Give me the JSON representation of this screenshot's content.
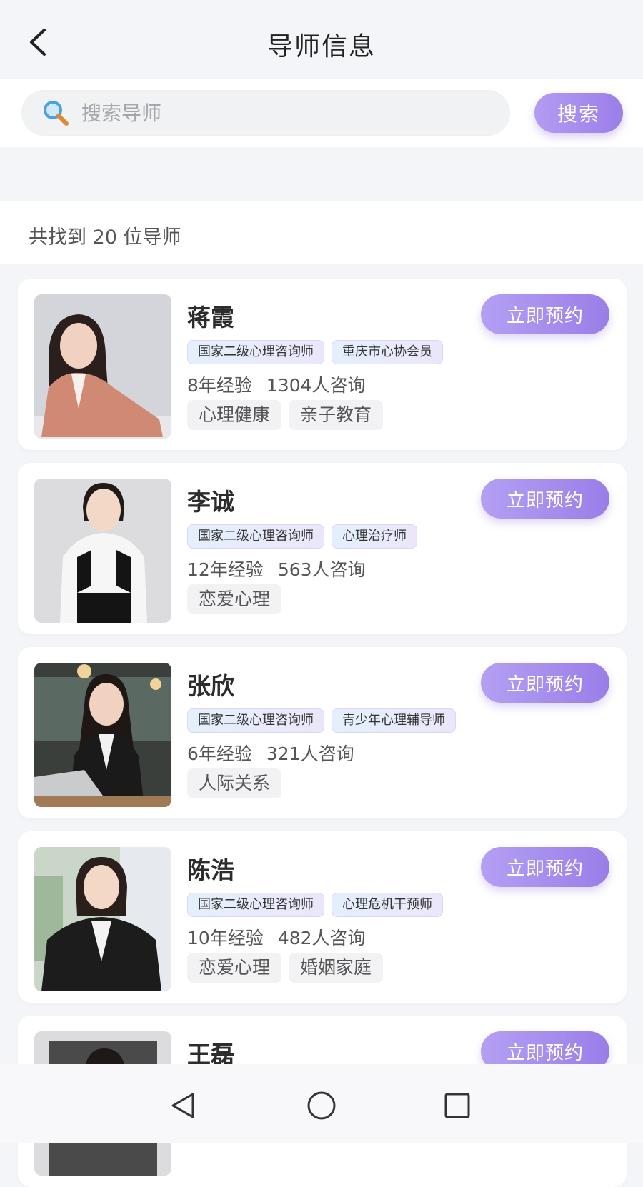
{
  "header": {
    "title": "导师信息",
    "back_icon": "back-arrow-icon"
  },
  "search": {
    "placeholder": "搜索导师",
    "value": "",
    "button_label": "搜索",
    "icon": "search-icon"
  },
  "results": {
    "count_text": "共找到 20 位导师"
  },
  "mentors": [
    {
      "name": "蒋霞",
      "certs": [
        "国家二级心理咨询师",
        "重庆市心协会员"
      ],
      "experience": "8年经验",
      "consults": "1304人咨询",
      "tags": [
        "心理健康",
        "亲子教育"
      ],
      "button_label": "立即预约"
    },
    {
      "name": "李诚",
      "certs": [
        "国家二级心理咨询师",
        "心理治疗师"
      ],
      "experience": "12年经验",
      "consults": "563人咨询",
      "tags": [
        "恋爱心理"
      ],
      "button_label": "立即预约"
    },
    {
      "name": "张欣",
      "certs": [
        "国家二级心理咨询师",
        "青少年心理辅导师"
      ],
      "experience": "6年经验",
      "consults": "321人咨询",
      "tags": [
        "人际关系"
      ],
      "button_label": "立即预约"
    },
    {
      "name": "陈浩",
      "certs": [
        "国家二级心理咨询师",
        "心理危机干预师"
      ],
      "experience": "10年经验",
      "consults": "482人咨询",
      "tags": [
        "恋爱心理",
        "婚姻家庭"
      ],
      "button_label": "立即预约"
    },
    {
      "name": "王磊",
      "certs": [],
      "experience": "",
      "consults": "",
      "tags": [],
      "button_label": "立即预约"
    }
  ],
  "colors": {
    "accent_start": "#b49ff3",
    "accent_end": "#9a7ee8",
    "page_bg": "#f4f5f8"
  },
  "system_nav": {
    "back": "triangle-back-icon",
    "home": "circle-home-icon",
    "recent": "square-recent-icon"
  }
}
